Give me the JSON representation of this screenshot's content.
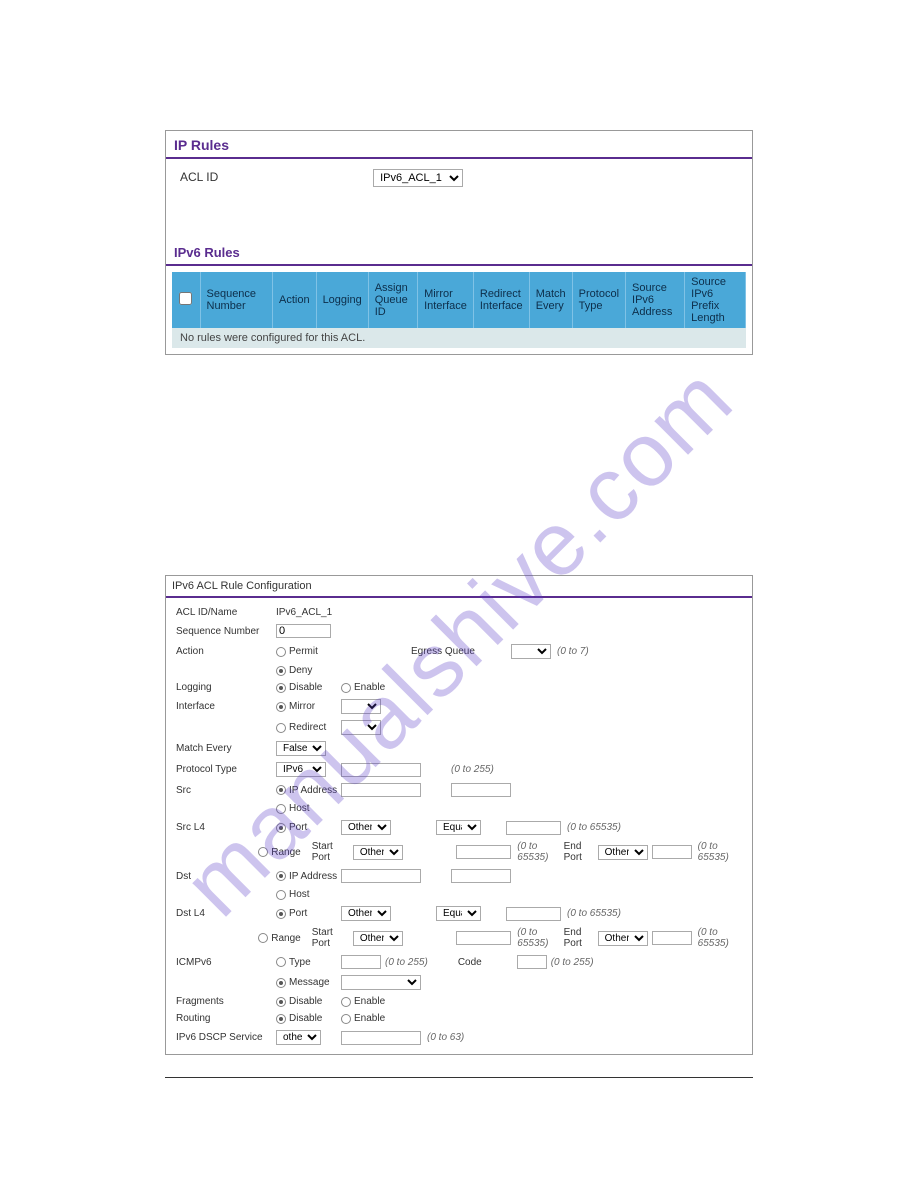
{
  "watermark": "manualshive.com",
  "panel1": {
    "title_ip_rules": "IP Rules",
    "acl_id_label": "ACL ID",
    "acl_id_value": "IPv6_ACL_1",
    "title_ipv6_rules": "IPv6 Rules",
    "headers": [
      "Sequence Number",
      "Action",
      "Logging",
      "Assign\nQueue ID",
      "Mirror\nInterface",
      "Redirect\nInterface",
      "Match\nEvery",
      "Protocol\nType",
      "Source\nIPv6 Address",
      "Source\nIPv6 Prefix Length"
    ],
    "empty_msg": "No rules were configured for this ACL."
  },
  "panel2": {
    "title": "IPv6 ACL Rule Configuration",
    "rows": {
      "acl_id_name": {
        "label": "ACL ID/Name",
        "value": "IPv6_ACL_1"
      },
      "seq": {
        "label": "Sequence Number",
        "value": "0"
      },
      "action": {
        "label": "Action",
        "permit": "Permit",
        "deny": "Deny",
        "egress": "Egress Queue",
        "hint": "(0 to 7)"
      },
      "logging": {
        "label": "Logging",
        "disable": "Disable",
        "enable": "Enable"
      },
      "interface": {
        "label": "Interface",
        "mirror": "Mirror",
        "redirect": "Redirect"
      },
      "match_every": {
        "label": "Match Every",
        "value": "False"
      },
      "protocol": {
        "label": "Protocol Type",
        "value": "IPv6",
        "hint": "(0 to 255)"
      },
      "src": {
        "label": "Src",
        "ip": "IP Address",
        "host": "Host"
      },
      "srcl4": {
        "label": "Src L4",
        "port": "Port",
        "range": "Range",
        "start": "Start Port",
        "other": "Other",
        "equal": "Equal",
        "hint_port": "(0 to 65535)",
        "endport": "End Port"
      },
      "dst": {
        "label": "Dst",
        "ip": "IP Address",
        "host": "Host"
      },
      "dstl4": {
        "label": "Dst L4",
        "port": "Port",
        "range": "Range",
        "start": "Start Port",
        "other": "Other",
        "equal": "Equal",
        "hint_port": "(0 to 65535)",
        "endport": "End Port"
      },
      "icmpv6": {
        "label": "ICMPv6",
        "type": "Type",
        "msg": "Message",
        "hint": "(0 to 255)",
        "code": "Code"
      },
      "fragments": {
        "label": "Fragments",
        "disable": "Disable",
        "enable": "Enable"
      },
      "routing": {
        "label": "Routing",
        "disable": "Disable",
        "enable": "Enable"
      },
      "dscp": {
        "label": "IPv6 DSCP Service",
        "other": "other",
        "hint": "(0 to 63)"
      }
    }
  }
}
